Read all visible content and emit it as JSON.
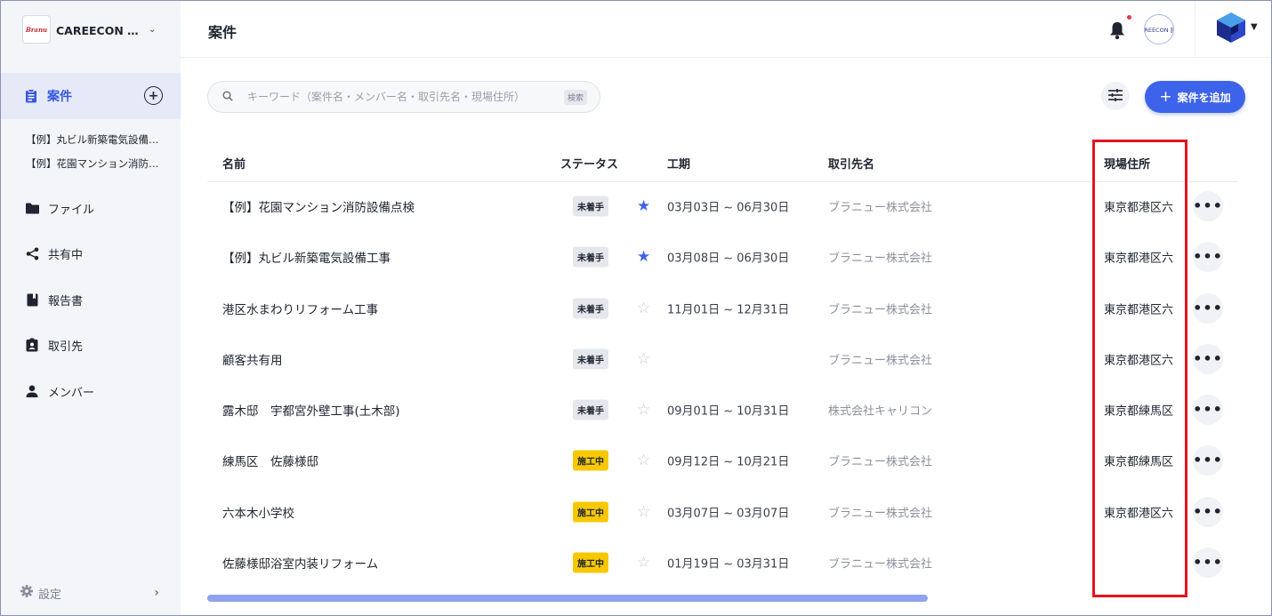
{
  "org": {
    "logo_text": "Branu",
    "name": "CAREECON 施工管理",
    "chevron": "⌄"
  },
  "sidebar": {
    "active": {
      "label": "案件",
      "icon": "clipboard-icon"
    },
    "recent": [
      "【例】丸ビル新築電気設備工事",
      "【例】花園マンション消防設備点検"
    ],
    "items": [
      {
        "label": "ファイル",
        "icon": "folder-icon"
      },
      {
        "label": "共有中",
        "icon": "share-icon"
      },
      {
        "label": "報告書",
        "icon": "book-icon"
      },
      {
        "label": "取引先",
        "icon": "contact-badge-icon"
      },
      {
        "label": "メンバー",
        "icon": "person-icon"
      }
    ],
    "settings_label": "設定"
  },
  "header": {
    "title": "案件",
    "company_avatar": "CAREECON 施工",
    "notification_dot": true
  },
  "search": {
    "placeholder": "キーワード（案件名・メンバー名・取引先名・現場住所）",
    "kbd": "検索"
  },
  "toolbar": {
    "add_label": "案件を追加"
  },
  "table": {
    "columns": {
      "name": "名前",
      "status": "ステータス",
      "period": "工期",
      "client": "取引先名",
      "address": "現場住所"
    },
    "rows": [
      {
        "name": "【例】花園マンション消防設備点検",
        "status": "未着手",
        "status_type": "gray",
        "starred": true,
        "period": "03月03日 ~ 06月30日",
        "client": "ブラニュー株式会社",
        "address": "東京都港区六"
      },
      {
        "name": "【例】丸ビル新築電気設備工事",
        "status": "未着手",
        "status_type": "gray",
        "starred": true,
        "period": "03月08日 ~ 06月30日",
        "client": "ブラニュー株式会社",
        "address": "東京都港区六"
      },
      {
        "name": "港区水まわりリフォーム工事",
        "status": "未着手",
        "status_type": "gray",
        "starred": false,
        "period": "11月01日 ~ 12月31日",
        "client": "ブラニュー株式会社",
        "address": "東京都港区六"
      },
      {
        "name": "顧客共有用",
        "status": "未着手",
        "status_type": "gray",
        "starred": false,
        "period": "",
        "client": "ブラニュー株式会社",
        "address": "東京都港区六"
      },
      {
        "name": "露木邸　宇都宮外壁工事(土木部)",
        "status": "未着手",
        "status_type": "gray",
        "starred": false,
        "period": "09月01日 ~ 10月31日",
        "client": "株式会社キャリコン",
        "address": "東京都練馬区"
      },
      {
        "name": "練馬区　佐藤様邸",
        "status": "施工中",
        "status_type": "yellow",
        "starred": false,
        "period": "09月12日 ~ 10月21日",
        "client": "ブラニュー株式会社",
        "address": "東京都練馬区"
      },
      {
        "name": "六本木小学校",
        "status": "施工中",
        "status_type": "yellow",
        "starred": false,
        "period": "03月07日 ~ 03月07日",
        "client": "ブラニュー株式会社",
        "address": "東京都港区六"
      },
      {
        "name": "佐藤様邸浴室内装リフォーム",
        "status": "施工中",
        "status_type": "yellow",
        "starred": false,
        "period": "01月19日 ~ 03月31日",
        "client": "ブラニュー株式会社",
        "address": ""
      }
    ]
  },
  "colors": {
    "accent": "#3d63ea",
    "highlight": "#e3141e",
    "status_yellow": "#f7c800",
    "status_gray": "#e5e7ec"
  }
}
